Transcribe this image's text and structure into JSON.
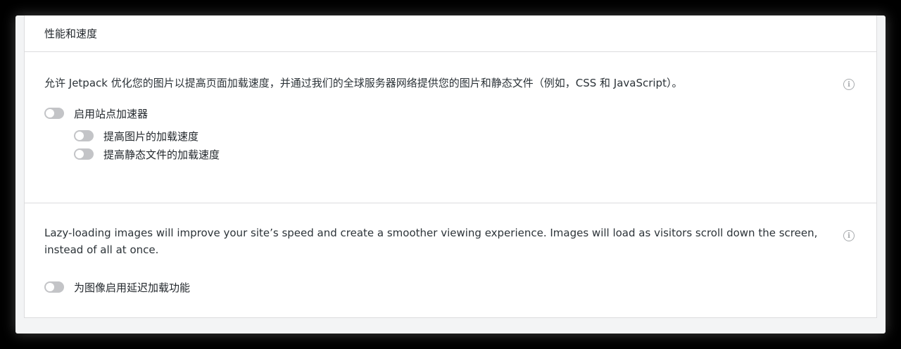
{
  "header": {
    "title": "性能和速度"
  },
  "accelerator": {
    "description": "允许 Jetpack 优化您的图片以提高页面加载速度，并通过我们的全球服务器网络提供您的图片和静态文件（例如，CSS 和 JavaScript）。",
    "info_icon": "info-icon",
    "main_toggle": {
      "label": "启用站点加速器",
      "enabled": false
    },
    "sub_toggles": [
      {
        "label": "提高图片的加载速度",
        "enabled": false
      },
      {
        "label": "提高静态文件的加载速度",
        "enabled": false
      }
    ]
  },
  "lazy_loading": {
    "description": "Lazy-loading images will improve your site’s speed and create a smoother viewing experience. Images will load as visitors scroll down the screen, instead of all at once.",
    "info_icon": "info-icon",
    "toggle": {
      "label": "为图像启用延迟加载功能",
      "enabled": false
    }
  },
  "colors": {
    "toggle_off": "#c3c4c7",
    "border": "#dcdcde",
    "text": "#2c3338",
    "icon": "#a7aaad"
  }
}
